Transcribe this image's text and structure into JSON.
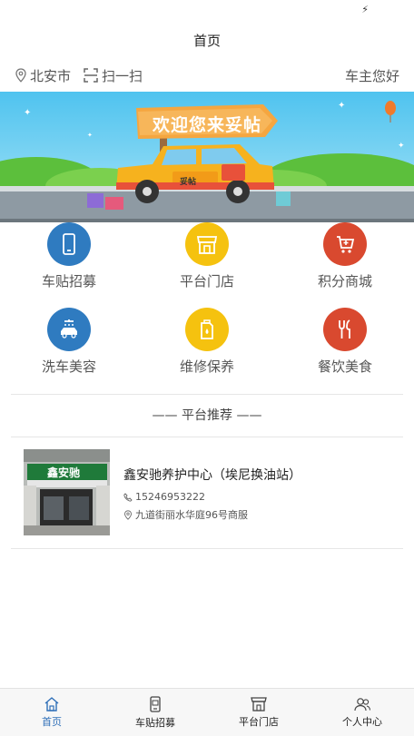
{
  "header": {
    "title": "首页"
  },
  "location_bar": {
    "city": "北安市",
    "scan_label": "扫一扫",
    "greeting": "车主您好"
  },
  "banner": {
    "headline": "欢迎您来妥帖",
    "car_logo": "妥帖"
  },
  "categories": [
    {
      "label": "车贴招募",
      "icon": "phone-icon",
      "color": "#2f7bc0"
    },
    {
      "label": "平台门店",
      "icon": "store-icon",
      "color": "#f5c20f"
    },
    {
      "label": "积分商城",
      "icon": "cart-icon",
      "color": "#d9492f"
    },
    {
      "label": "洗车美容",
      "icon": "car-wash-icon",
      "color": "#2f7bc0"
    },
    {
      "label": "维修保养",
      "icon": "oil-can-icon",
      "color": "#f5c20f"
    },
    {
      "label": "餐饮美食",
      "icon": "dining-icon",
      "color": "#d9492f"
    }
  ],
  "recommend": {
    "title": "—— 平台推荐 ——",
    "stores": [
      {
        "name": "鑫安驰养护中心（埃尼换油站）",
        "phone": "15246953222",
        "address": "九道街丽水华庭96号商服",
        "sign_text": "鑫安驰"
      }
    ]
  },
  "tabbar": [
    {
      "label": "首页",
      "icon": "home-icon",
      "active": true
    },
    {
      "label": "车贴招募",
      "icon": "phone-icon",
      "active": false
    },
    {
      "label": "平台门店",
      "icon": "store-icon",
      "active": false
    },
    {
      "label": "个人中心",
      "icon": "user-icon",
      "active": false
    }
  ],
  "colors": {
    "accent": "#2f6fb8",
    "blue": "#2f7bc0",
    "yellow": "#f5c20f",
    "red": "#d9492f"
  }
}
